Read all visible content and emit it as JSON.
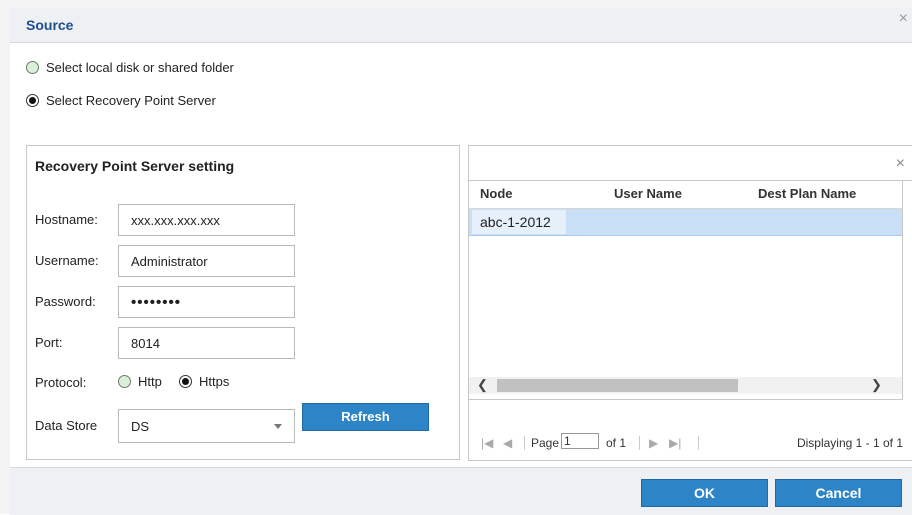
{
  "dialog": {
    "title": "Source",
    "close": "×"
  },
  "source_options": [
    {
      "label": "Select local disk or shared folder",
      "checked": false
    },
    {
      "label": "Select Recovery Point Server",
      "checked": true
    }
  ],
  "rps": {
    "title": "Recovery Point Server setting",
    "hostname": {
      "label": "Hostname:",
      "value": "xxx.xxx.xxx.xxx"
    },
    "username": {
      "label": "Username:",
      "value": "Administrator"
    },
    "password": {
      "label": "Password:",
      "value": "••••••••"
    },
    "port": {
      "label": "Port:",
      "value": "8014"
    },
    "protocol": {
      "label": "Protocol:",
      "options": [
        "Http",
        "Https"
      ],
      "selected": "Https"
    },
    "datastore": {
      "label": "Data Store",
      "value": "DS"
    },
    "refresh_label": "Refresh"
  },
  "grid": {
    "clear": "×",
    "columns": [
      "Node",
      "User Name",
      "Dest Plan Name"
    ],
    "rows": [
      {
        "node": "abc-1-2012",
        "user": "",
        "plan": ""
      }
    ],
    "scroll_left": "❮",
    "scroll_right": "❯"
  },
  "pager": {
    "first": "|◀",
    "prev": "◀",
    "page_label": "Page",
    "page_value": "1",
    "of_label": "of 1",
    "next": "▶",
    "last": "▶|",
    "display": "Displaying 1 - 1 of 1"
  },
  "buttons": {
    "ok": "OK",
    "cancel": "Cancel"
  },
  "colors": {
    "accent": "#2d85c7",
    "title": "#1f4e8c",
    "selection": "#c9dff5"
  }
}
